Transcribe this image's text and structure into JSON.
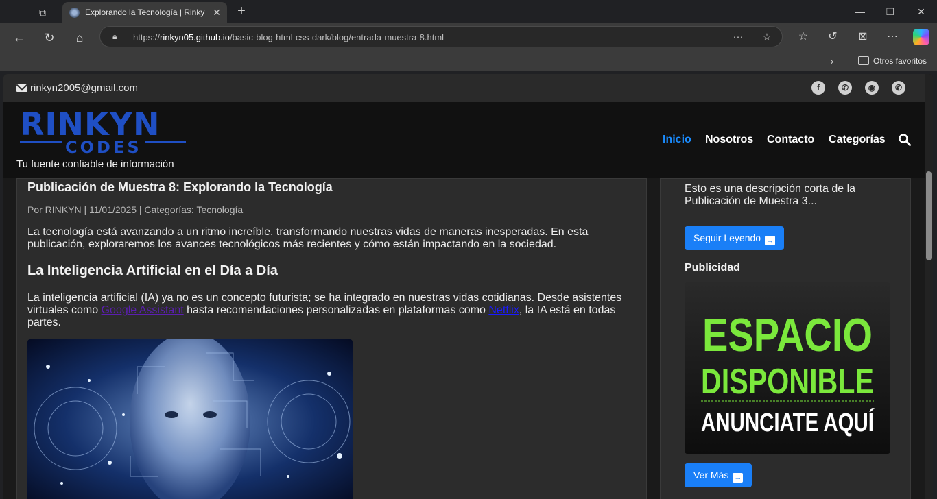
{
  "browser": {
    "tab_title": "Explorando la Tecnología | Rinkyn Codes",
    "url_prefix": "https://",
    "url_host": "rinkyn05.github.io",
    "url_path": "/basic-blog-html-css-dark/blog/entrada-muestra-8.html",
    "bookmark_folder": "Otros favoritos"
  },
  "topbar": {
    "email": "rinkyn2005@gmail.com",
    "social": [
      "facebook-icon",
      "whatsapp-icon",
      "github-icon",
      "whatsapp-icon"
    ]
  },
  "header": {
    "logo_main": "RINKYN",
    "logo_sub": "CODES",
    "tagline": "Tu fuente confiable de información",
    "nav": [
      "Inicio",
      "Nosotros",
      "Contacto",
      "Categorías"
    ]
  },
  "article": {
    "title": "Publicación de Muestra 8: Explorando la Tecnología",
    "meta": "Por RINKYN | 11/01/2025 | Categorías: Tecnología",
    "intro": "La tecnología está avanzando a un ritmo increíble, transformando nuestras vidas de maneras inesperadas. En esta publicación, exploraremos los avances tecnológicos más recientes y cómo están impactando en la sociedad.",
    "h2": "La Inteligencia Artificial en el Día a Día",
    "p2_a": "La inteligencia artificial (IA) ya no es un concepto futurista; se ha integrado en nuestras vidas cotidianas. Desde asistentes virtuales como ",
    "link1": "Google Assistant",
    "p2_b": " hasta recomendaciones personalizadas en plataformas como ",
    "link2": "Netflix",
    "p2_c": ", la IA está en todas partes."
  },
  "sidebar": {
    "desc": "Esto es una descripción corta de la Publicación de Muestra 3...",
    "read_more": "Seguir Leyendo",
    "ads_heading": "Publicidad",
    "ad_line1": "ESPACIO",
    "ad_line2": "DISPONIBLE",
    "ad_line3": "ANUNCIATE AQUÍ",
    "see_more": "Ver Más"
  }
}
